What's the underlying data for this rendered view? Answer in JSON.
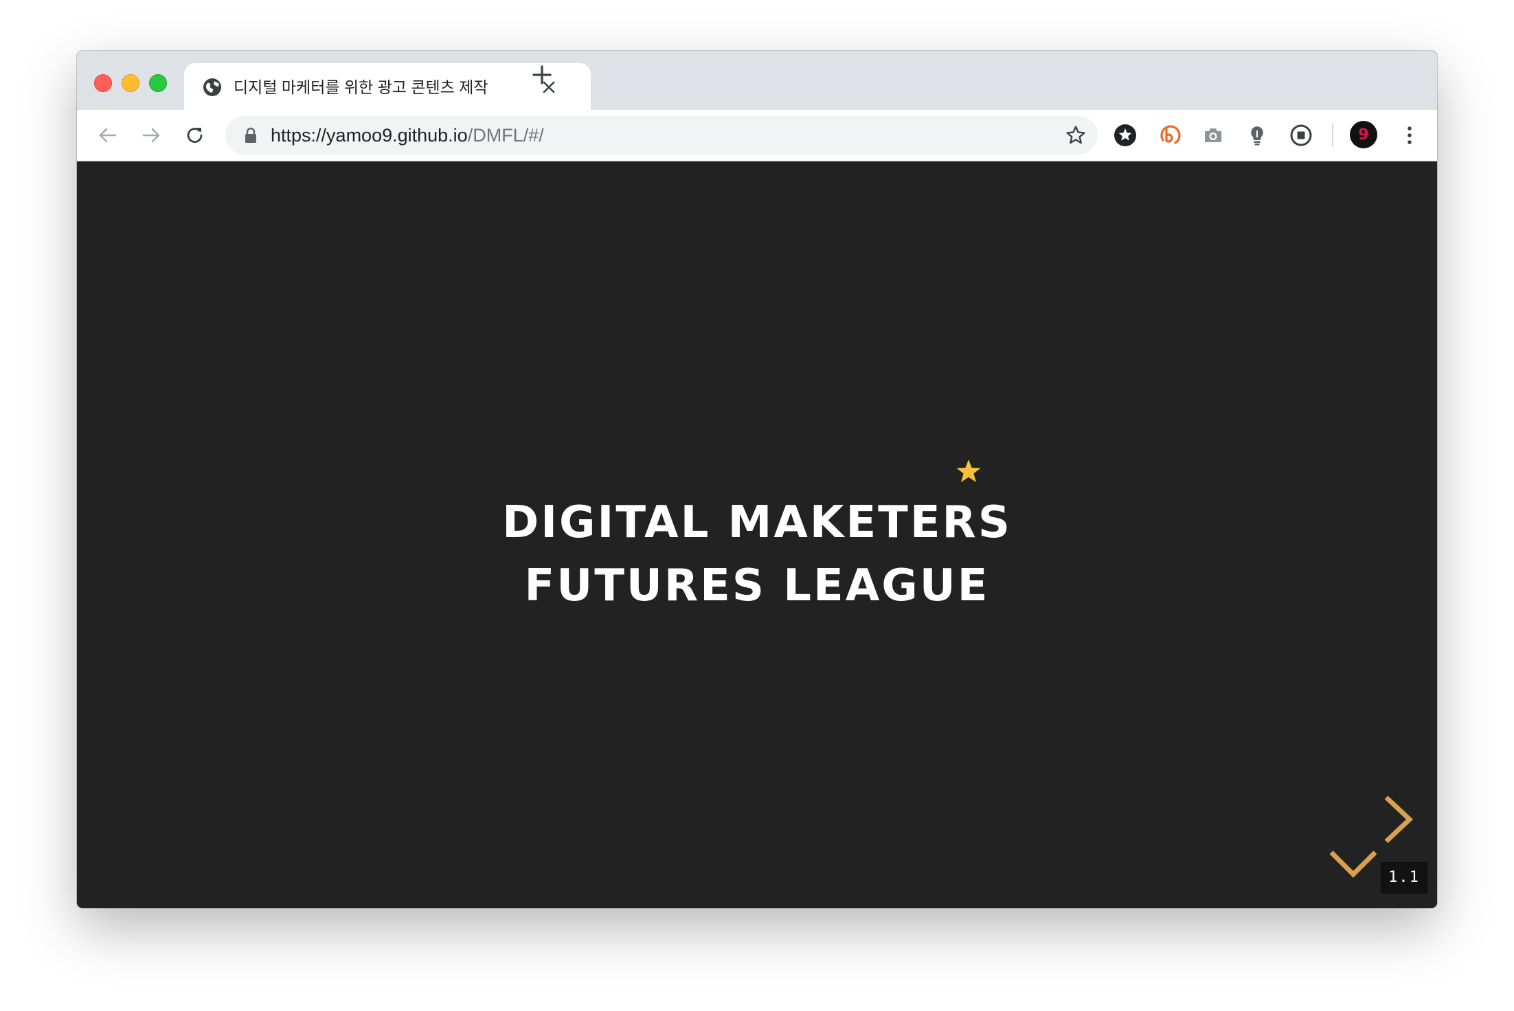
{
  "browser": {
    "tab": {
      "title": "디지털 마케터를 위한 광고 콘텐츠 제작",
      "favicon": "globe-icon"
    },
    "new_tab_icon": "plus-icon",
    "nav": {
      "back_icon": "arrow-left-icon",
      "forward_icon": "arrow-right-icon",
      "reload_icon": "reload-icon"
    },
    "address_bar": {
      "scheme": "https://",
      "domain": "yamoo9.github.io",
      "path": "/DMFL/#/",
      "secure_icon": "lock-icon",
      "bookmark_icon": "star-outline-icon"
    },
    "extensions": [
      {
        "name": "star-extension-icon"
      },
      {
        "name": "b-extension-icon",
        "color": "#f26522"
      },
      {
        "name": "camera-extension-icon"
      },
      {
        "name": "lightbulb-extension-icon"
      },
      {
        "name": "stop-extension-icon"
      }
    ],
    "profile": {
      "label": "9",
      "color": "#e2134b"
    },
    "menu_icon": "kebab-menu-icon"
  },
  "slide": {
    "title_line1": "DIGITAL MAKETERS",
    "title_line2": "FUTURES LEAGUE",
    "accent_color": "#f5c13a",
    "control_color": "#d9a14e",
    "slide_number": "1.1"
  }
}
